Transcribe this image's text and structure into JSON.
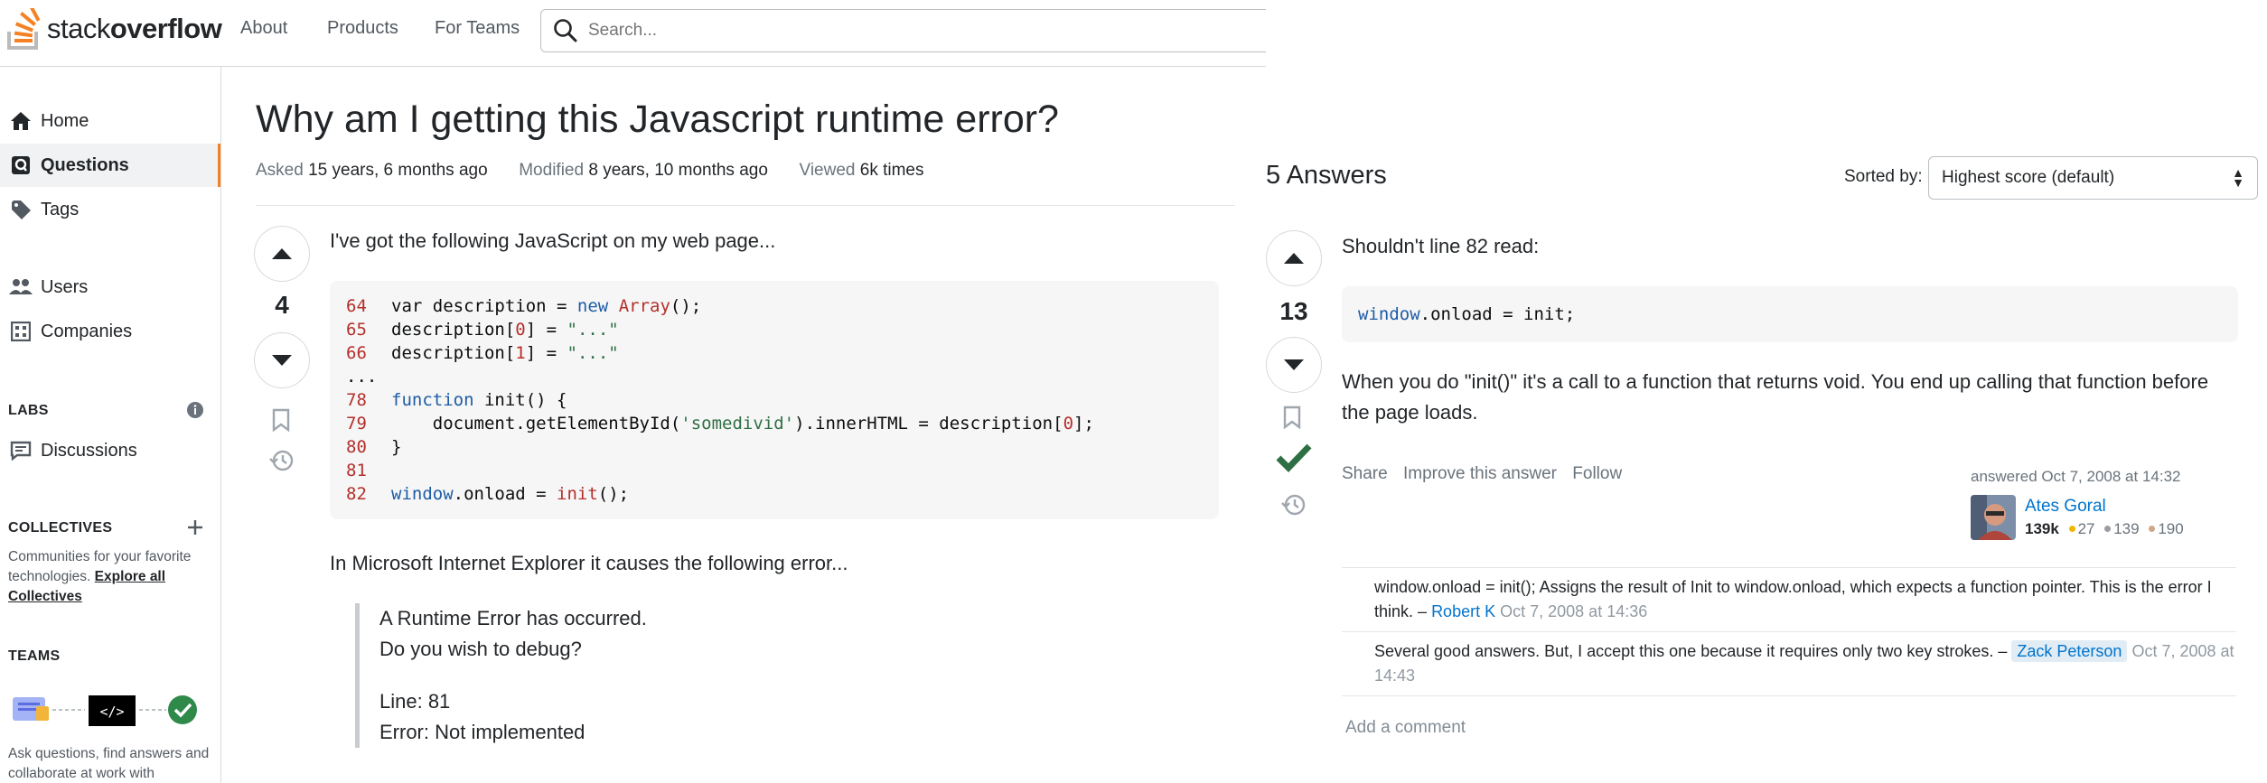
{
  "brand": {
    "word1": "stack",
    "word2": "overflow"
  },
  "nav": {
    "about": "About",
    "products": "Products",
    "for_teams": "For Teams"
  },
  "search": {
    "placeholder": "Search..."
  },
  "sidebar": {
    "items": [
      {
        "label": "Home",
        "icon": "home-icon"
      },
      {
        "label": "Questions",
        "icon": "questions-icon",
        "active": true
      },
      {
        "label": "Tags",
        "icon": "tag-icon"
      },
      {
        "label": "Users",
        "icon": "users-icon"
      },
      {
        "label": "Companies",
        "icon": "companies-icon"
      },
      {
        "label": "Discussions",
        "icon": "discussions-icon"
      }
    ],
    "labs": "LABS",
    "collectives": "COLLECTIVES",
    "collectives_text": "Communities for your favorite technologies.",
    "collectives_link": "Explore all Collectives",
    "teams": "TEAMS",
    "teams_text": "Ask questions, find answers and collaborate at work with"
  },
  "question": {
    "title": "Why am I getting this Javascript runtime error?",
    "asked_label": "Asked",
    "asked_value": "15 years, 6 months ago",
    "modified_label": "Modified",
    "modified_value": "8 years, 10 months ago",
    "viewed_label": "Viewed",
    "viewed_value": "6k times",
    "score": "4",
    "intro": "I've got the following JavaScript on my web page...",
    "followup": "In Microsoft Internet Explorer it causes the following error...",
    "quote": {
      "line1": "A Runtime Error has occurred.",
      "line2": "Do you wish to debug?",
      "line3": "Line: 81",
      "line4": "Error: Not implemented"
    }
  },
  "code": {
    "lines": [
      {
        "n": "64",
        "pre": "var description = ",
        "kw": "new",
        "mid": " ",
        "fn": "Array",
        "post": "();"
      },
      {
        "n": "65",
        "pre": "description[",
        "num": "0",
        "post2": "] = ",
        "str": "\"...\""
      },
      {
        "n": "66",
        "pre": "description[",
        "num": "1",
        "post2": "] = ",
        "str": "\"...\""
      },
      {
        "n": "...",
        "text": ""
      },
      {
        "n": "78",
        "kw": "function",
        "fnname": " init",
        "post": "() {"
      },
      {
        "n": "79",
        "text": "    document.getElementById(",
        "str": "'somedivid'",
        "post": ").innerHTML = description[",
        "num": "0",
        "tail": "];"
      },
      {
        "n": "80",
        "text": "}"
      },
      {
        "n": "81",
        "text": ""
      },
      {
        "n": "82",
        "kw": "window",
        "text": ".onload = ",
        "fn": "init",
        "post": "();"
      }
    ]
  },
  "answers": {
    "count_label": "5 Answers",
    "sorted_label": "Sorted by:",
    "sort_value": "Highest score (default)",
    "top": {
      "score": "13",
      "intro": "Shouldn't line 82 read:",
      "code_kw": "window",
      "code_rest": ".onload = init;",
      "explanation": "When you do \"init()\" it's a call to a function that returns void. You end up calling that function before the page loads.",
      "actions": {
        "share": "Share",
        "improve": "Improve this answer",
        "follow": "Follow"
      },
      "answered": "answered Oct 7, 2008 at 14:32",
      "user": "Ates Goral",
      "rep": "139k",
      "gold": "27",
      "silver": "139",
      "bronze": "190"
    },
    "comments": [
      {
        "text": "window.onload = init(); Assigns the result of Init to window.onload, which expects a function pointer. This is the error I think. –",
        "user": "Robert K",
        "date": "Oct 7, 2008 at 14:36",
        "op": false
      },
      {
        "text": "Several good answers. But, I accept this one because it requires only two key strokes. –",
        "user": "Zack Peterson",
        "date": "Oct 7, 2008 at 14:43",
        "op": true
      }
    ],
    "add_comment": "Add a comment"
  },
  "colors": {
    "accent": "#f48225",
    "link": "#0074cc",
    "accepted": "#2f6f44"
  }
}
